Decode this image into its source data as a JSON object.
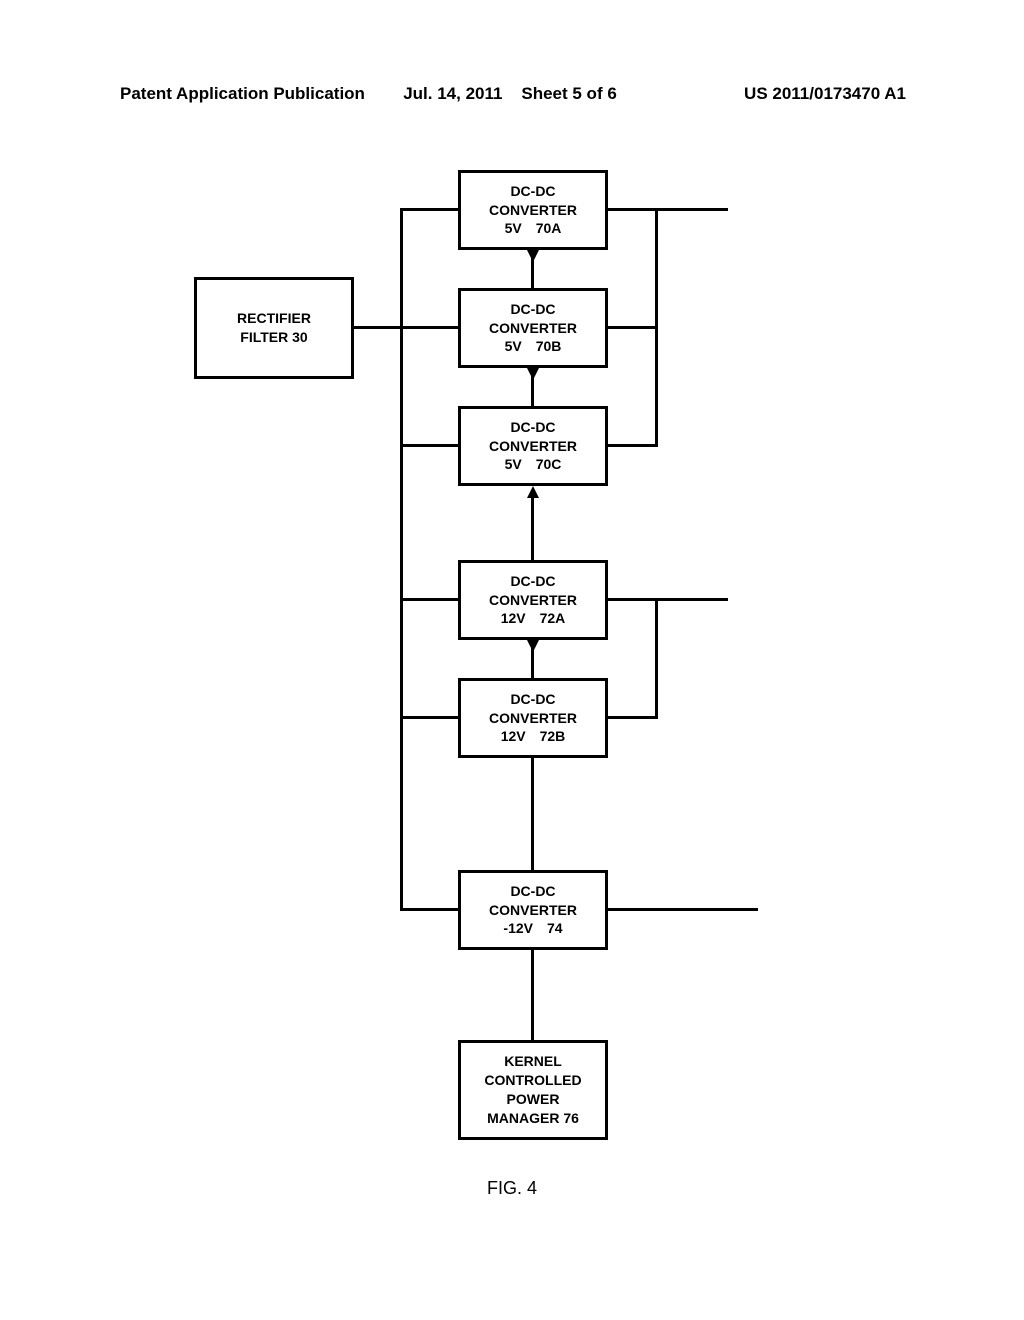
{
  "header": {
    "left": "Patent Application Publication",
    "mid_date": "Jul. 14, 2011",
    "mid_sheet": "Sheet 5 of 6",
    "right": "US 2011/0173470 A1"
  },
  "rectifier": {
    "line1": "RECTIFIER",
    "line2": "FILTER 30"
  },
  "converters": {
    "c70a": {
      "title": "DC-DC",
      "sub": "CONVERTER",
      "volt": "5V",
      "ref": "70A"
    },
    "c70b": {
      "title": "DC-DC",
      "sub": "CONVERTER",
      "volt": "5V",
      "ref": "70B"
    },
    "c70c": {
      "title": "DC-DC",
      "sub": "CONVERTER",
      "volt": "5V",
      "ref": "70C"
    },
    "c72a": {
      "title": "DC-DC",
      "sub": "CONVERTER",
      "volt": "12V",
      "ref": "72A"
    },
    "c72b": {
      "title": "DC-DC",
      "sub": "CONVERTER",
      "volt": "12V",
      "ref": "72B"
    },
    "c74": {
      "title": "DC-DC",
      "sub": "CONVERTER",
      "volt": "-12V",
      "ref": "74"
    }
  },
  "power_manager": {
    "l1": "KERNEL",
    "l2": "CONTROLLED",
    "l3": "POWER",
    "l4": "MANAGER 76"
  },
  "caption": "FIG. 4"
}
